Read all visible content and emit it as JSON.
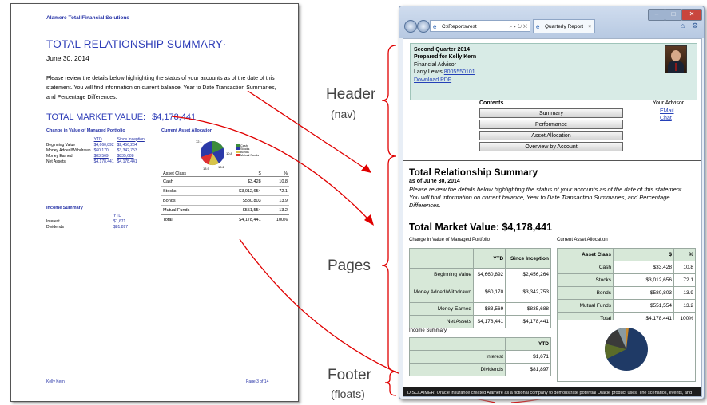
{
  "labels": {
    "header": "Header",
    "header_sub": "(nav)",
    "pages": "Pages",
    "footer": "Footer",
    "footer_sub": "(floats)"
  },
  "report": {
    "company": "Alamere Total Financial Solutions",
    "title": "TOTAL RELATIONSHIP SUMMARY·",
    "date": "June 30, 2014",
    "intro": "Please review the details below highlighting the status of your accounts as of the date of this statement. You will find information on current balance, Year to Date Transaction Summaries, and Percentage Differences.",
    "tmv_label": "TOTAL MARKET VALUE:",
    "tmv_value": "$4,178,441",
    "change_heading": "Change in Value of Managed Portfolio",
    "change_cols": [
      "YTD",
      "Since Inception"
    ],
    "change_rows": [
      {
        "label": "Beginning Value",
        "ytd": "$4,660,892",
        "since": "$2,456,264"
      },
      {
        "label": "Money Added/Withdrawn",
        "ytd": "$60,170",
        "since": "$3,342,753"
      },
      {
        "label": "Money Earned",
        "ytd": "$83,569",
        "since": "$835,688"
      },
      {
        "label": "Net Assets",
        "ytd": "$4,178,441",
        "since": "$4,178,441"
      }
    ],
    "alloc_heading": "Current Asset Allocation",
    "pie_labels": [
      "72.1",
      "10.8",
      "13.2",
      "13.9"
    ],
    "legend": [
      "Cash",
      "Stocks",
      "Bonds",
      "Mutual Funds"
    ],
    "alloc_cols": [
      "Asset Class",
      "$",
      "%"
    ],
    "alloc_rows": [
      {
        "c": "Cash",
        "v": "$3,428",
        "p": "10.8"
      },
      {
        "c": "Stocks",
        "v": "$3,012,654",
        "p": "72.1"
      },
      {
        "c": "Bonds",
        "v": "$580,803",
        "p": "13.9"
      },
      {
        "c": "Mutual Funds",
        "v": "$551,554",
        "p": "13.2"
      },
      {
        "c": "Total",
        "v": "$4,178,441",
        "p": "100%"
      }
    ],
    "income_heading": "Income Summary",
    "income_col": "YTD",
    "income_rows": [
      {
        "label": "Interest",
        "v": "$1,671"
      },
      {
        "label": "Dividends",
        "v": "$81,897"
      }
    ],
    "footer_left": "Kelly Kern",
    "footer_right": "Page 3 of 14"
  },
  "browser": {
    "address": "C:\\Reports\\rest",
    "tab_label": "Quarterly Report",
    "header": {
      "line1": "Second Quarter 2014",
      "line2": "Prepared for Kelly Kern",
      "line3": "Financial Advisor",
      "line4_name": "Larry Lewis",
      "line4_phone": "8005550101",
      "download": "Download PDF",
      "contents": "Contents",
      "nav": [
        "Summary",
        "Performance",
        "Asset Allocation",
        "Overview by Account"
      ],
      "advisor_heading": "Your Advisor",
      "email": "EMail",
      "chat": "Chat"
    },
    "page": {
      "title": "Total Relationship Summary",
      "as_of": "as of June 30, 2014",
      "intro": "Please review the details below highlighting the status of your accounts as of the date of this statement. You will find information on current balance, Year to Date Transaction Summaries, and Percentage Differences.",
      "tmv": "Total Market Value: $4,178,441",
      "change_heading": "Change in Value of Managed Portfolio",
      "change_cols": [
        "YTD",
        "Since Inception"
      ],
      "change_rows": [
        {
          "label": "Beginning Value",
          "ytd": "$4,660,892",
          "since": "$2,456,264"
        },
        {
          "label": "Money Added/Withdrawn",
          "ytd": "$60,170",
          "since": "$3,342,753"
        },
        {
          "label": "Money Earned",
          "ytd": "$83,569",
          "since": "$835,688"
        },
        {
          "label": "Net Assets",
          "ytd": "$4,178,441",
          "since": "$4,178,441"
        }
      ],
      "alloc_heading": "Current Asset Allocation",
      "alloc_cols": [
        "Asset Class",
        "$",
        "%"
      ],
      "alloc_rows": [
        {
          "c": "Cash",
          "v": "$33,428",
          "p": "10.8"
        },
        {
          "c": "Stocks",
          "v": "$3,012,656",
          "p": "72.1"
        },
        {
          "c": "Bonds",
          "v": "$580,803",
          "p": "13.9"
        },
        {
          "c": "Mutual Funds",
          "v": "$551,554",
          "p": "13.2"
        },
        {
          "c": "Total",
          "v": "$4,178,441",
          "p": "100%"
        }
      ],
      "income_heading": "Income Summary",
      "income_col": "YTD",
      "income_rows": [
        {
          "label": "Interest",
          "v": "$1,671"
        },
        {
          "label": "Dividends",
          "v": "$81,897"
        }
      ],
      "disclaimer": "DISCLAIMER: Oracle insurance created Alamere as a fictional company to demonstrate potential Oracle product uses. The scenarios, events, and people depicted herein are fictional, and any similarity to real persons or events are coincidental and"
    }
  },
  "colors": {
    "accent_blue": "#2e3db8",
    "arrow_red": "#e00000",
    "header_green": "#d8ebe6"
  }
}
